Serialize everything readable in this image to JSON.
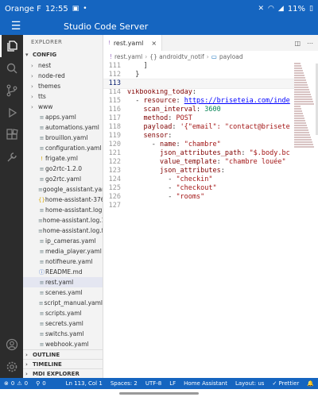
{
  "status_bar": {
    "carrier": "Orange F",
    "time": "12:55",
    "battery": "11%"
  },
  "app": {
    "title": "Studio Code Server"
  },
  "sidebar": {
    "title": "EXPLORER",
    "root_label": "CONFIG",
    "items": [
      {
        "type": "folder",
        "label": "nest"
      },
      {
        "type": "folder",
        "label": "node-red"
      },
      {
        "type": "folder",
        "label": "themes"
      },
      {
        "type": "folder",
        "label": "tts"
      },
      {
        "type": "folder",
        "label": "www"
      },
      {
        "type": "file",
        "icon": "yaml",
        "label": "apps.yaml"
      },
      {
        "type": "file",
        "icon": "yaml",
        "label": "automations.yaml"
      },
      {
        "type": "file",
        "icon": "yaml",
        "label": "brouillon.yaml"
      },
      {
        "type": "file",
        "icon": "yaml",
        "label": "configuration.yaml"
      },
      {
        "type": "file",
        "icon": "warn",
        "label": "frigate.yml"
      },
      {
        "type": "file",
        "icon": "yaml",
        "label": "go2rtc-1.2.0"
      },
      {
        "type": "file",
        "icon": "yaml",
        "label": "go2rtc.yaml"
      },
      {
        "type": "file",
        "icon": "yaml",
        "label": "google_assistant.yaml"
      },
      {
        "type": "file",
        "icon": "json",
        "label": "home-assistant-3765..."
      },
      {
        "type": "file",
        "icon": "log",
        "label": "home-assistant.log"
      },
      {
        "type": "file",
        "icon": "log",
        "label": "home-assistant.log.1"
      },
      {
        "type": "file",
        "icon": "log",
        "label": "home-assistant.log.fa..."
      },
      {
        "type": "file",
        "icon": "yaml",
        "label": "ip_cameras.yaml"
      },
      {
        "type": "file",
        "icon": "yaml",
        "label": "media_player.yaml"
      },
      {
        "type": "file",
        "icon": "yaml",
        "label": "notifheure.yaml"
      },
      {
        "type": "file",
        "icon": "info",
        "label": "README.md"
      },
      {
        "type": "file",
        "icon": "yaml",
        "label": "rest.yaml",
        "selected": true
      },
      {
        "type": "file",
        "icon": "yaml",
        "label": "scenes.yaml"
      },
      {
        "type": "file",
        "icon": "yaml",
        "label": "script_manual.yaml"
      },
      {
        "type": "file",
        "icon": "yaml",
        "label": "scripts.yaml"
      },
      {
        "type": "file",
        "icon": "yaml",
        "label": "secrets.yaml"
      },
      {
        "type": "file",
        "icon": "yaml",
        "label": "switchs.yaml"
      },
      {
        "type": "file",
        "icon": "yaml",
        "label": "webhook.yaml"
      }
    ],
    "bottom_sections": [
      "OUTLINE",
      "TIMELINE",
      "MDI EXPLORER"
    ]
  },
  "editor": {
    "tab_label": "rest.yaml",
    "breadcrumb": [
      "rest.yaml",
      "{} androidtv_notif",
      "payload"
    ],
    "lines": [
      {
        "num": "111",
        "text": "    ]"
      },
      {
        "num": "112",
        "text": "  }"
      },
      {
        "num": "113",
        "text": ""
      },
      {
        "num": "114",
        "text": "vikbooking_today:"
      },
      {
        "num": "115",
        "text": "  - resource: https://briseteia.com/inde"
      },
      {
        "num": "116",
        "text": "    scan_interval: 3600"
      },
      {
        "num": "117",
        "text": "    method: POST"
      },
      {
        "num": "118",
        "text": "    payload: '{\"email\": \"contact@brisete"
      },
      {
        "num": "119",
        "text": "    sensor:"
      },
      {
        "num": "120",
        "text": "      - name: \"chambre\""
      },
      {
        "num": "121",
        "text": "        json_attributes_path: \"$.body.bc"
      },
      {
        "num": "122",
        "text": "        value_template: \"chambre louée\""
      },
      {
        "num": "123",
        "text": "        json_attributes:"
      },
      {
        "num": "124",
        "text": "          - \"checkin\""
      },
      {
        "num": "125",
        "text": "          - \"checkout\""
      },
      {
        "num": "126",
        "text": "          - \"rooms\""
      },
      {
        "num": "127",
        "text": ""
      }
    ]
  },
  "status": {
    "errors": "0",
    "warnings": "0",
    "ports": "0",
    "position": "Ln 113, Col 1",
    "spaces": "Spaces: 2",
    "encoding": "UTF-8",
    "eol": "LF",
    "language": "Home Assistant",
    "layout": "Layout: us",
    "prettier": "✓ Prettier"
  }
}
